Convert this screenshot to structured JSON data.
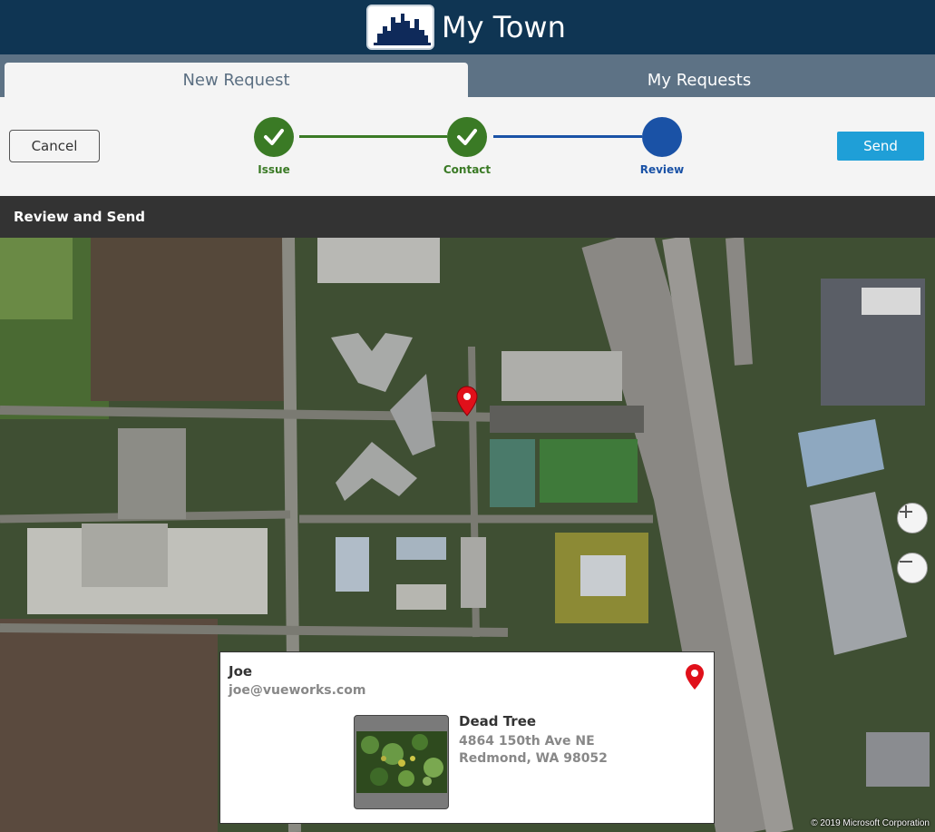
{
  "app": {
    "title": "My Town"
  },
  "tabs": [
    {
      "label": "New Request",
      "active": true
    },
    {
      "label": "My Requests",
      "active": false
    }
  ],
  "toolbar": {
    "cancel_label": "Cancel",
    "send_label": "Send"
  },
  "steps": [
    {
      "label": "Issue",
      "status": "complete"
    },
    {
      "label": "Contact",
      "status": "complete"
    },
    {
      "label": "Review",
      "status": "current"
    }
  ],
  "section": {
    "title": "Review and Send"
  },
  "map": {
    "copyright": "© 2019 Microsoft Corporation",
    "zoom_in_icon": "plus-icon",
    "zoom_out_icon": "minus-icon",
    "marker_icon": "map-pin-icon"
  },
  "review": {
    "name": "Joe",
    "email": "joe@vueworks.com",
    "issue": "Dead Tree",
    "address_line1": "4864 150th Ave NE",
    "address_line2": "Redmond, WA 98052"
  },
  "colors": {
    "header": "#0f3553",
    "tab_bar": "#5d7285",
    "step_complete": "#3a7a25",
    "step_current": "#1a52a6",
    "send": "#1f9fd7",
    "pin": "#e0101a"
  }
}
